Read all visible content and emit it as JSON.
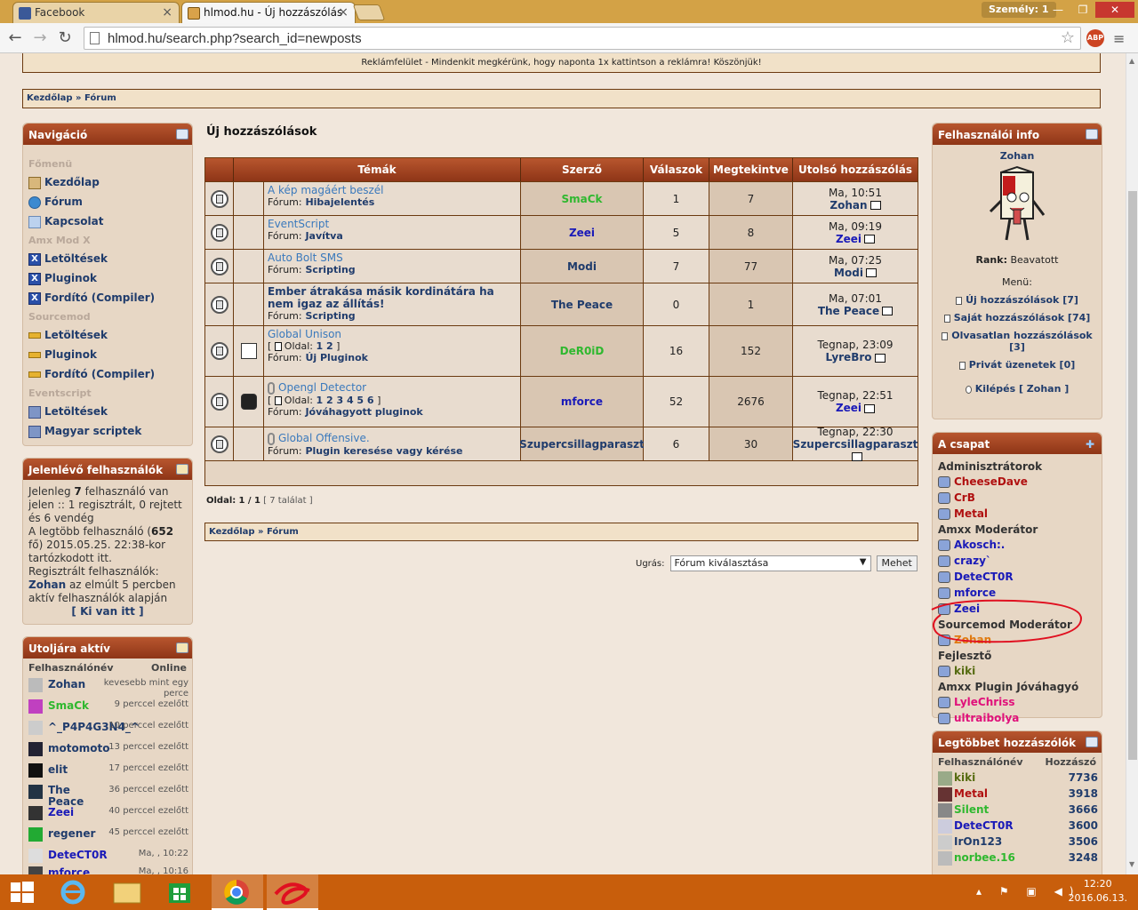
{
  "browser": {
    "tabs": [
      {
        "label": "Facebook",
        "active": false
      },
      {
        "label": "hlmod.hu - Új hozzászólás",
        "active": true
      }
    ],
    "person_badge": "Személy: 1",
    "url": "hlmod.hu/search.php?search_id=newposts",
    "abp_label": "ABP"
  },
  "ad_text": "Reklámfelület - Mindenkit megkérünk, hogy naponta 1x kattintson a reklámra! Köszönjük!",
  "breadcrumb": {
    "home": "Kezdőlap",
    "sep": "»",
    "forum": "Fórum"
  },
  "nav": {
    "title": "Navigáció",
    "sections": [
      {
        "heading": "Főmenü",
        "items": [
          "Kezdőlap",
          "Fórum",
          "Kapcsolat"
        ]
      },
      {
        "heading": "Amx Mod X",
        "items": [
          "Letöltések",
          "Pluginok",
          "Fordító (Compiler)"
        ]
      },
      {
        "heading": "Sourcemod",
        "items": [
          "Letöltések",
          "Pluginok",
          "Fordító (Compiler)"
        ]
      },
      {
        "heading": "Eventscript",
        "items": [
          "Letöltések",
          "Magyar scriptek"
        ]
      }
    ]
  },
  "online": {
    "title": "Jelenlévő felhasználók",
    "line1_pre": "Jelenleg ",
    "line1_num": "7",
    "line1_post": " felhasználó van jelen :: 1 regisztrált, 0 rejtett és 6 vendég",
    "line2_pre": "A legtöbb felhasználó (",
    "line2_num": "652",
    "line2_post": " fő) 2015.05.25. 22:38-kor tartózkodott itt.",
    "line3": "Regisztrált felhasználók:",
    "user": "Zohan",
    "line4": " az elmúlt 5 percben aktív felhasználók alapján",
    "who_link": "[ Ki van itt ]"
  },
  "last_active": {
    "title": "Utoljára aktív",
    "col_user": "Felhasználónév",
    "col_online": "Online",
    "rows": [
      {
        "name": "Zohan",
        "time": "kevesebb mint egy perce",
        "color": "#203c6c"
      },
      {
        "name": "SmaCk",
        "time": "9 perccel ezelőtt",
        "color": "#2fb82f"
      },
      {
        "name": "^_P4P4G3N4_^",
        "time": "10 perccel ezelőtt",
        "color": "#203c6c"
      },
      {
        "name": "motomoto",
        "time": "13 perccel ezelőtt",
        "color": "#203c6c"
      },
      {
        "name": "elit",
        "time": "17 perccel ezelőtt",
        "color": "#203c6c"
      },
      {
        "name": "The Peace",
        "time": "36 perccel ezelőtt",
        "color": "#203c6c"
      },
      {
        "name": "Zeei",
        "time": "40 perccel ezelőtt",
        "color": "#1a1ab8"
      },
      {
        "name": "regener",
        "time": "45 perccel ezelőtt",
        "color": "#203c6c"
      },
      {
        "name": "DeteCT0R",
        "time": "Ma, , 10:22",
        "color": "#1a1ab8"
      },
      {
        "name": "mforce",
        "time": "Ma, , 10:16",
        "color": "#1a1ab8"
      }
    ]
  },
  "main": {
    "title": "Új hozzászólások",
    "columns": [
      "Témák",
      "Szerző",
      "Válaszok",
      "Megtekintve",
      "Utolsó hozzászólás"
    ],
    "forum_prefix": "Fórum:",
    "page_prefix": "Oldal:",
    "topics": [
      {
        "title": "A kép magáért beszél",
        "forum": "Hibajelentés",
        "author": "SmaCk",
        "author_color": "#2fb82f",
        "replies": "1",
        "views": "7",
        "last_time": "Ma, 10:51",
        "last_user": "Zohan",
        "last_color": "#203c6c",
        "pages": "",
        "clip": false,
        "type_icon": "none",
        "dark": false
      },
      {
        "title": "EventScript",
        "forum": "Javítva",
        "author": "Zeei",
        "author_color": "#1a1ab8",
        "replies": "5",
        "views": "8",
        "last_time": "Ma, 09:19",
        "last_user": "Zeei",
        "last_color": "#1a1ab8",
        "pages": "",
        "clip": false,
        "type_icon": "none",
        "dark": false
      },
      {
        "title": "Auto Bolt SMS",
        "forum": "Scripting",
        "author": "Modi",
        "author_color": "#203c6c",
        "replies": "7",
        "views": "77",
        "last_time": "Ma, 07:25",
        "last_user": "Modi",
        "last_color": "#203c6c",
        "pages": "",
        "clip": false,
        "type_icon": "none",
        "dark": false
      },
      {
        "title": "Ember átrakása másik kordinátára ha nem igaz az állítás!",
        "forum": "Scripting",
        "author": "The Peace",
        "author_color": "#203c6c",
        "replies": "0",
        "views": "1",
        "last_time": "Ma, 07:01",
        "last_user": "The Peace",
        "last_color": "#203c6c",
        "pages": "",
        "clip": false,
        "type_icon": "none",
        "dark": true
      },
      {
        "title": "Global Unison",
        "forum": "Új Pluginok",
        "author": "DeR0iD",
        "author_color": "#2fb82f",
        "replies": "16",
        "views": "152",
        "last_time": "Tegnap, 23:09",
        "last_user": "LyreBro",
        "last_color": "#203c6c",
        "pages": "1 2",
        "clip": false,
        "type_icon": "cs",
        "dark": false
      },
      {
        "title": "Opengl Detector",
        "forum": "Jóváhagyott pluginok",
        "author": "mforce",
        "author_color": "#1a1ab8",
        "replies": "52",
        "views": "2676",
        "last_time": "Tegnap, 22:51",
        "last_user": "Zeei",
        "last_color": "#1a1ab8",
        "pages": "1 2 3 4 5 6",
        "clip": true,
        "type_icon": "steam",
        "dark": false
      },
      {
        "title": "Global Offensive.",
        "forum": "Plugin keresése vagy kérése",
        "author": "Szupercsillagparaszt",
        "author_color": "#203c6c",
        "replies": "6",
        "views": "30",
        "last_time": "Tegnap, 22:30",
        "last_user": "Szupercsillagparaszt",
        "last_color": "#203c6c",
        "pages": "",
        "clip": true,
        "type_icon": "none",
        "dark": false
      }
    ],
    "pagination": {
      "label": "Oldal:",
      "current": "1 / 1",
      "hits": "[ 7 találat ]"
    },
    "jump": {
      "label": "Ugrás:",
      "select": "Fórum kiválasztása",
      "button": "Mehet"
    }
  },
  "userinfo": {
    "title": "Felhasználói info",
    "name": "Zohan",
    "rank_label": "Rank:",
    "rank": "Beavatott",
    "menu_label": "Menü:",
    "links": [
      "Új hozzászólások [7]",
      "Saját hozzászólások [74]",
      "Olvasatlan hozzászólások [3]",
      "Privát üzenetek [0]"
    ],
    "logout": "Kilépés [ Zohan ]"
  },
  "team": {
    "title": "A csapat",
    "groups": [
      {
        "name": "Adminisztrátorok",
        "members": [
          {
            "n": "CheeseDave",
            "c": "#b01010"
          },
          {
            "n": "CrB",
            "c": "#b01010"
          },
          {
            "n": "Metal",
            "c": "#b01010"
          }
        ]
      },
      {
        "name": "Amxx Moderátor",
        "members": [
          {
            "n": "Akosch:.",
            "c": "#1a1ab8"
          },
          {
            "n": "crazy`",
            "c": "#1a1ab8"
          },
          {
            "n": "DeteCT0R",
            "c": "#1a1ab8"
          },
          {
            "n": "mforce",
            "c": "#1a1ab8"
          },
          {
            "n": "Zeei",
            "c": "#1a1ab8"
          }
        ]
      },
      {
        "name": "Sourcemod Moderátor",
        "members": [
          {
            "n": "Zohan",
            "c": "#e07a10"
          }
        ]
      },
      {
        "name": "Fejlesztő",
        "members": [
          {
            "n": "kiki",
            "c": "#556b10"
          }
        ]
      },
      {
        "name": "Amxx Plugin Jóváhagyó",
        "members": [
          {
            "n": "LyleChriss",
            "c": "#e0107a"
          },
          {
            "n": "ultraibolya",
            "c": "#e0107a"
          }
        ]
      }
    ]
  },
  "top_posters": {
    "title": "Legtöbbet hozzászólók",
    "col_user": "Felhasználónév",
    "col_posts": "Hozzászó",
    "rows": [
      {
        "name": "kiki",
        "count": "7736",
        "color": "#556b10"
      },
      {
        "name": "Metal",
        "count": "3918",
        "color": "#b01010"
      },
      {
        "name": "Silent",
        "count": "3666",
        "color": "#2fb82f"
      },
      {
        "name": "DeteCT0R",
        "count": "3600",
        "color": "#1a1ab8"
      },
      {
        "name": "IrOn123",
        "count": "3506",
        "color": "#203c6c"
      },
      {
        "name": "norbee.16",
        "count": "3248",
        "color": "#2fb82f"
      }
    ]
  },
  "taskbar": {
    "clock_time": "12:20",
    "clock_date": "2016.06.13."
  },
  "colors": {
    "header_gradient_top": "#b8562e",
    "header_gradient_bottom": "#8e3517",
    "link": "#203c6c",
    "taskbar": "#c85e0c",
    "annotation_red": "#e01020"
  }
}
